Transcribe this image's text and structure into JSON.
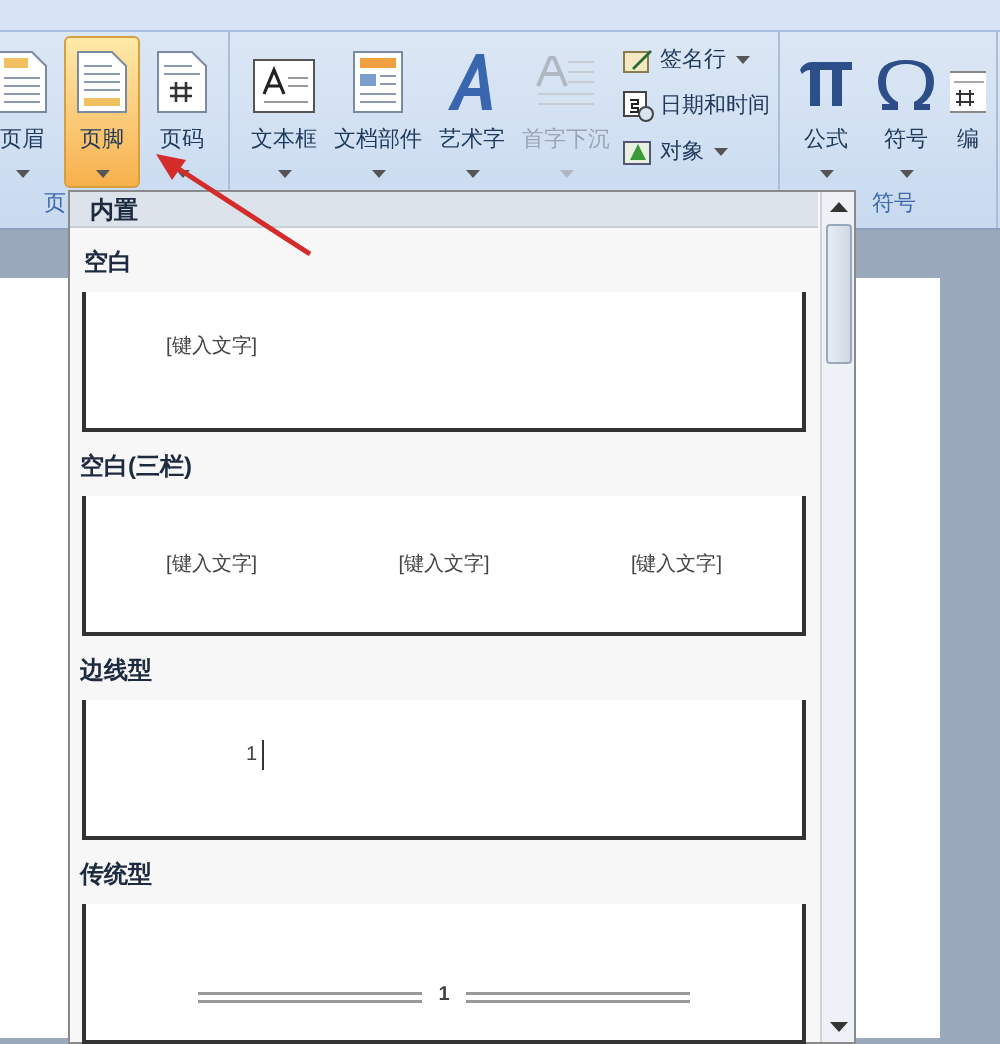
{
  "ribbon": {
    "groups": [
      {
        "label": "页",
        "buttons": [
          {
            "label": "页眉",
            "selected": false,
            "disabled": false,
            "dropdown": true
          },
          {
            "label": "页脚",
            "selected": true,
            "disabled": false,
            "dropdown": true
          },
          {
            "label": "页码",
            "selected": false,
            "disabled": false,
            "dropdown": true
          }
        ]
      },
      {
        "buttons": [
          {
            "label": "文本框",
            "selected": false,
            "disabled": false,
            "dropdown": true
          },
          {
            "label": "文档部件",
            "selected": false,
            "disabled": false,
            "dropdown": true
          },
          {
            "label": "艺术字",
            "selected": false,
            "disabled": false,
            "dropdown": true
          },
          {
            "label": "首字下沉",
            "selected": false,
            "disabled": true,
            "dropdown": true
          }
        ],
        "small_buttons": [
          {
            "label": "签名行",
            "dropdown": true
          },
          {
            "label": "日期和时间",
            "dropdown": false
          },
          {
            "label": "对象",
            "dropdown": true
          }
        ]
      },
      {
        "label": "符号",
        "buttons": [
          {
            "label": "公式",
            "selected": false,
            "disabled": false,
            "dropdown": true
          },
          {
            "label": "符号",
            "selected": false,
            "disabled": false,
            "dropdown": true
          },
          {
            "label": "编",
            "selected": false,
            "disabled": false,
            "dropdown": false
          }
        ]
      }
    ]
  },
  "footer_gallery": {
    "section": "内置",
    "items": [
      {
        "title": "空白",
        "kind": "blank",
        "texts": [
          "[键入文字]"
        ]
      },
      {
        "title": "空白(三栏)",
        "kind": "three",
        "texts": [
          "[键入文字]",
          "[键入文字]",
          "[键入文字]"
        ]
      },
      {
        "title": "边线型",
        "kind": "sideline",
        "texts": [
          "1"
        ]
      },
      {
        "title": "传统型",
        "kind": "traditional",
        "texts": [
          "1"
        ]
      }
    ]
  }
}
